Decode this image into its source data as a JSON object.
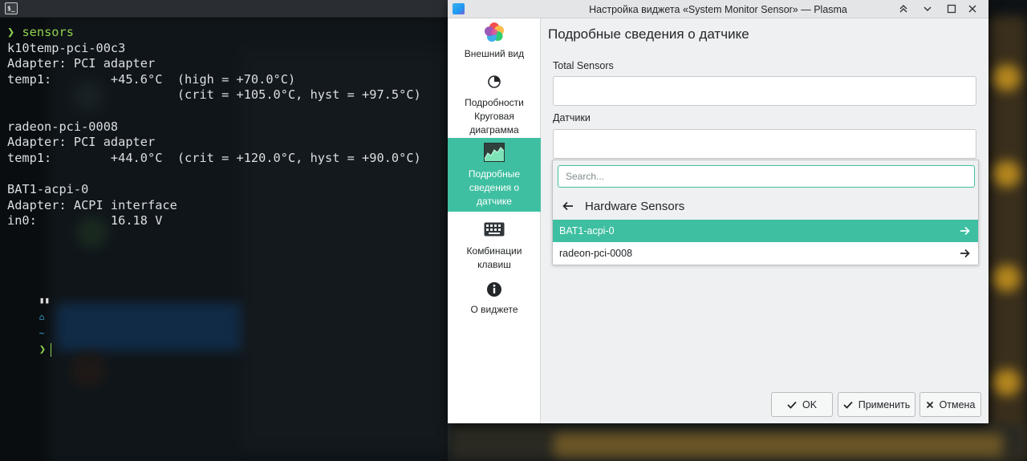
{
  "terminal": {
    "command": "sensors",
    "lines": [
      "k10temp-pci-00c3",
      "Adapter: PCI adapter",
      "temp1:        +45.6°C  (high = +70.0°C)",
      "                       (crit = +105.0°C, hyst = +97.5°C)",
      "",
      "radeon-pci-0008",
      "Adapter: PCI adapter",
      "temp1:        +44.0°C  (crit = +120.0°C, hyst = +90.0°C)",
      "",
      "BAT1-acpi-0",
      "Adapter: ACPI interface",
      "in0:          16.18 V"
    ],
    "prompt_glyph": "❯",
    "prompt_home_glyph": "⌂",
    "prompt_dir": "~",
    "terminal_icon_text": "$_"
  },
  "dialog": {
    "title": "Настройка виджета «System Monitor Sensor» — Plasma",
    "sidebar": {
      "items": [
        {
          "label_lines": [
            "Внешний вид"
          ],
          "icon": "palette-icon"
        },
        {
          "label_lines": [
            "Подробности",
            "Круговая",
            "диаграмма"
          ],
          "icon": "pie-chart-icon"
        },
        {
          "label_lines": [
            "Подробные",
            "сведения о",
            "датчике"
          ],
          "icon": "sensor-graph-icon"
        },
        {
          "label_lines": [
            "Комбинации",
            "клавиш"
          ],
          "icon": "keyboard-icon"
        },
        {
          "label_lines": [
            "О виджете"
          ],
          "icon": "info-icon"
        }
      ],
      "active_index": 2
    },
    "content": {
      "page_title": "Подробные сведения о датчике",
      "total_sensors_label": "Total Sensors",
      "sensors_label": "Датчики",
      "picker": {
        "search_placeholder": "Search...",
        "breadcrumb": "Hardware Sensors",
        "rows": [
          "BAT1-acpi-0",
          "radeon-pci-0008"
        ],
        "selected_index": 0
      }
    },
    "buttons": {
      "ok": "OK",
      "apply": "Применить",
      "cancel": "Отмена"
    }
  },
  "colors": {
    "accent": "#3fbfa1",
    "terminal_text": "#dcdfe2",
    "prompt_green": "#8fd14f",
    "prompt_blue": "#3daee9"
  }
}
